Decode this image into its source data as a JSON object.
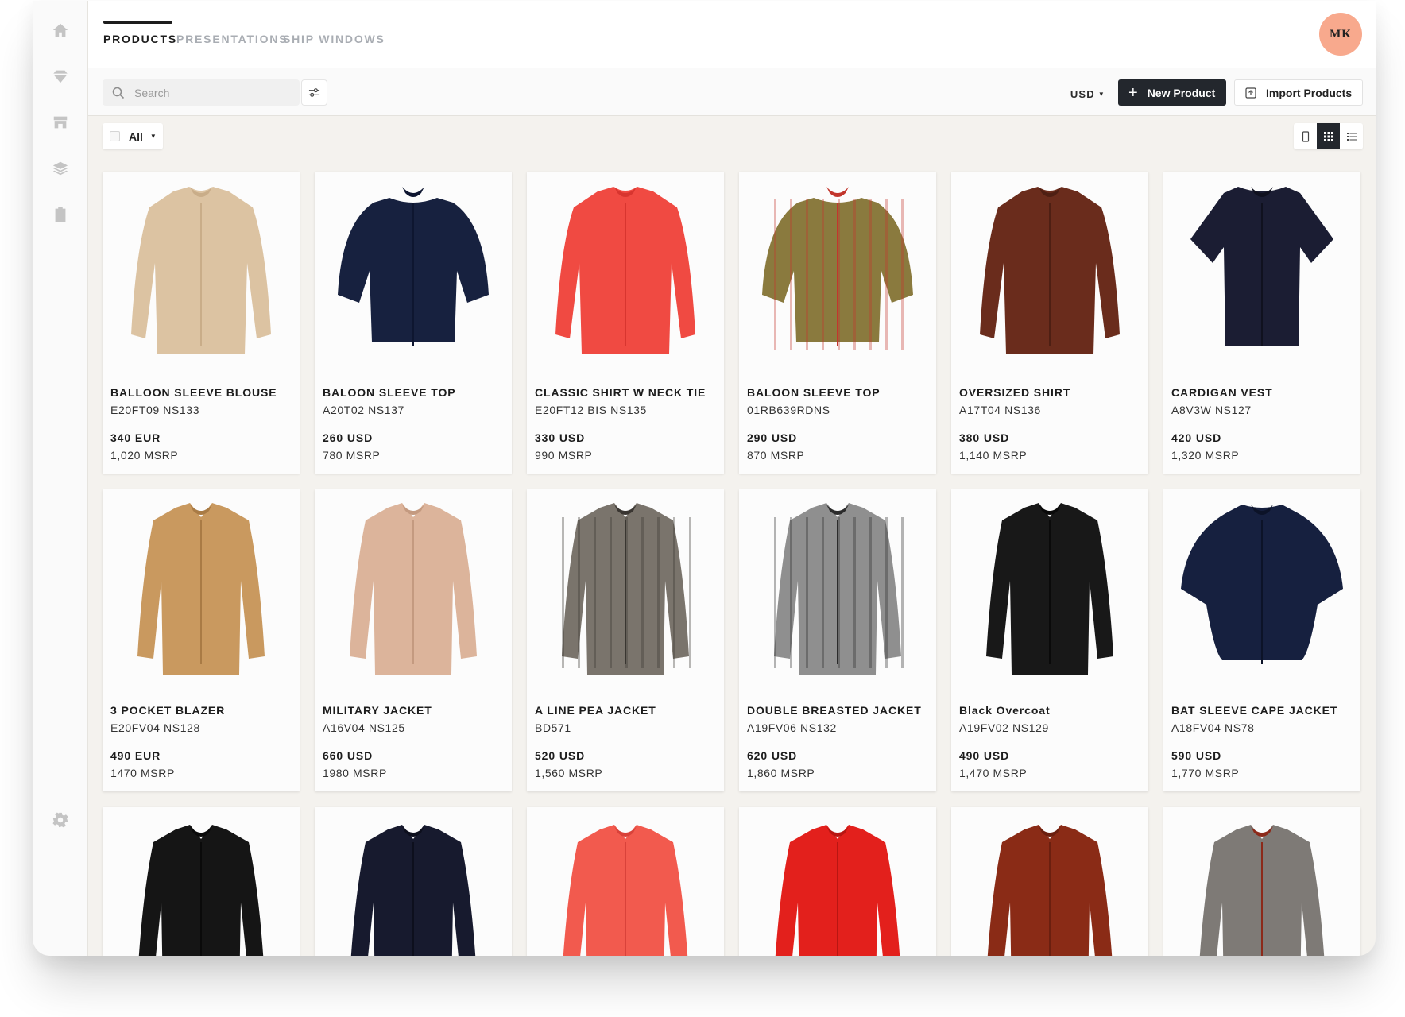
{
  "nav": {
    "tabs": [
      {
        "label": "PRODUCTS",
        "active": true
      },
      {
        "label": "PRESENTATIONS",
        "active": false
      },
      {
        "label": "SHIP WINDOWS",
        "active": false
      }
    ],
    "avatar_initials": "MK",
    "avatar_color": "#f8a98d"
  },
  "sidebar": {
    "icons": [
      "home-icon",
      "gem-icon",
      "store-icon",
      "layers-icon",
      "clipboard-icon",
      "gear-icon"
    ]
  },
  "toolbar": {
    "search_placeholder": "Search",
    "currency": "USD",
    "new_product_label": "New Product",
    "import_label": "Import Products"
  },
  "filter": {
    "selection_label": "All",
    "view_modes": [
      "single-view-icon",
      "grid-view-icon",
      "list-view-icon"
    ],
    "active_view": "grid"
  },
  "products": [
    {
      "name": "BALLOON SLEEVE BLOUSE",
      "sku": "E20FT09 NS133",
      "price": "340 EUR",
      "msrp": "1,020 MSRP",
      "color": "#dcc3a2",
      "accent": "#c9ad89",
      "shape": "blouse"
    },
    {
      "name": "BALOON SLEEVE TOP",
      "sku": "A20T02 NS137",
      "price": "260 USD",
      "msrp": "780 MSRP",
      "color": "#17213f",
      "accent": "#0e1630",
      "shape": "top"
    },
    {
      "name": "CLASSIC SHIRT W NECK TIE",
      "sku": "E20FT12 BIS NS135",
      "price": "330 USD",
      "msrp": "990 MSRP",
      "color": "#f04a42",
      "accent": "#d8352f",
      "shape": "shirt"
    },
    {
      "name": "BALOON SLEEVE TOP",
      "sku": "01RB639RDNS",
      "price": "290 USD",
      "msrp": "870 MSRP",
      "color": "#8a7a3e",
      "accent": "#c2362d",
      "shape": "plaid"
    },
    {
      "name": "OVERSIZED SHIRT",
      "sku": "A17T04 NS136",
      "price": "380 USD",
      "msrp": "1,140 MSRP",
      "color": "#6a2c1c",
      "accent": "#4e1f13",
      "shape": "longshirt"
    },
    {
      "name": "CARDIGAN VEST",
      "sku": "A8V3W NS127",
      "price": "420 USD",
      "msrp": "1,320 MSRP",
      "color": "#1b1d33",
      "accent": "#10111f",
      "shape": "vest"
    },
    {
      "name": "3 POCKET BLAZER",
      "sku": "E20FV04 NS128",
      "price": "490 EUR",
      "msrp": "1470 MSRP",
      "color": "#c9995f",
      "accent": "#a97b45",
      "shape": "blazer"
    },
    {
      "name": "MILITARY JACKET",
      "sku": "A16V04 NS125",
      "price": "660 USD",
      "msrp": "1980 MSRP",
      "color": "#dcb49b",
      "accent": "#c49a80",
      "shape": "military"
    },
    {
      "name": "A LINE PEA JACKET",
      "sku": "BD571",
      "price": "520 USD",
      "msrp": "1,560 MSRP",
      "color": "#7a746c",
      "accent": "#3a3632",
      "shape": "pea"
    },
    {
      "name": "DOUBLE BREASTED JACKET",
      "sku": "A19FV06 NS132",
      "price": "620 USD",
      "msrp": "1,860 MSRP",
      "color": "#8f8f8f",
      "accent": "#2b2b2b",
      "shape": "double"
    },
    {
      "name": "Black Overcoat",
      "sku": "A19FV02 NS129",
      "price": "490 USD",
      "msrp": "1,470 MSRP",
      "color": "#181818",
      "accent": "#0a0a0a",
      "shape": "overcoat"
    },
    {
      "name": "BAT SLEEVE CAPE JACKET",
      "sku": "A18FV04 NS78",
      "price": "590 USD",
      "msrp": "1,770 MSRP",
      "color": "#16203f",
      "accent": "#0c1328",
      "shape": "cape"
    }
  ],
  "products_partial": [
    {
      "color": "#151515",
      "accent": "#0a0a0a"
    },
    {
      "color": "#171a2e",
      "accent": "#0d0f1d"
    },
    {
      "color": "#f25a4e",
      "accent": "#d9423a"
    },
    {
      "color": "#e3201c",
      "accent": "#b81612"
    },
    {
      "color": "#8a2b16",
      "accent": "#6b1f0f"
    },
    {
      "color": "#7e7a76",
      "accent": "#8c2a1a"
    }
  ]
}
